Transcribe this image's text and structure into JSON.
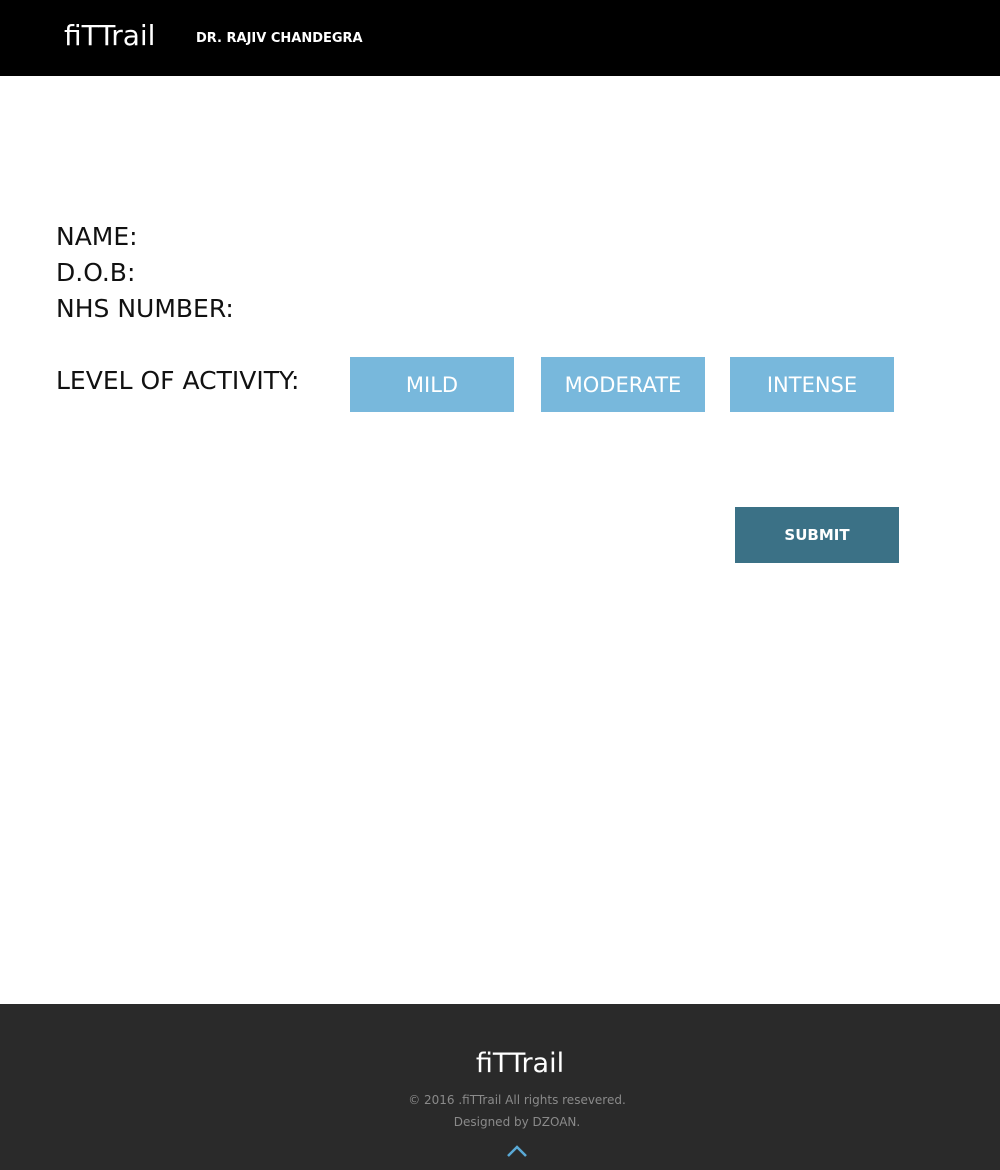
{
  "header": {
    "brand": "fiTTrail",
    "doctor_name": "DR. RAJIV CHANDEGRA"
  },
  "form": {
    "name_label": "NAME:",
    "dob_label": "D.O.B:",
    "nhs_label": "NHS NUMBER:",
    "activity_label": "LEVEL OF ACTIVITY:",
    "activity_options": [
      "MILD",
      "MODERATE",
      "INTENSE"
    ],
    "submit_label": "SUBMIT"
  },
  "footer": {
    "brand": "fiTTrail",
    "copyright": "© 2016 .fiTTrail All rights resevered.",
    "designed_by": "Designed by DZOAN."
  },
  "colors": {
    "topbar": "#000000",
    "activity_button": "#78b8dc",
    "submit_button": "#3b7186",
    "footer": "#2a2a2a",
    "arrow": "#5aa9d6"
  },
  "icons": {
    "scroll_top": "chevron-up-icon"
  }
}
